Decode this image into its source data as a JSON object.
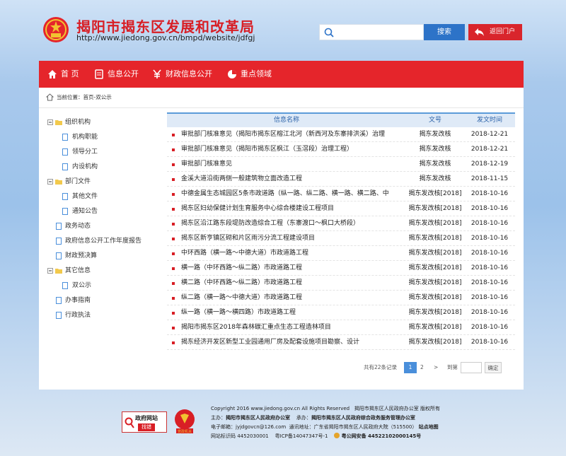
{
  "header": {
    "title": "揭阳市揭东区发展和改革局",
    "url": "http://www.jiedong.gov.cn/bmpd/website/jdfgj",
    "search_placeholder": "",
    "search_button": "搜索",
    "return_button": "返回门户"
  },
  "nav": [
    {
      "label": "首 页",
      "icon": "home-icon"
    },
    {
      "label": "信息公开",
      "icon": "document-icon"
    },
    {
      "label": "财政信息公开",
      "icon": "money-icon"
    },
    {
      "label": "重点领域",
      "icon": "pie-chart-icon"
    }
  ],
  "breadcrumb": "当前位置：首页-双公示",
  "tree": [
    {
      "label": "组织机构",
      "type": "folder"
    },
    {
      "label": "机构职能",
      "type": "file"
    },
    {
      "label": "领导分工",
      "type": "file"
    },
    {
      "label": "内设机构",
      "type": "file"
    },
    {
      "label": "部门文件",
      "type": "folder"
    },
    {
      "label": "其他文件",
      "type": "file"
    },
    {
      "label": "通知公告",
      "type": "file"
    },
    {
      "label": "政务动态",
      "type": "file"
    },
    {
      "label": "政府信息公开工作年度报告",
      "type": "file"
    },
    {
      "label": "财政预决算",
      "type": "file"
    },
    {
      "label": "其它信息",
      "type": "folder"
    },
    {
      "label": "双公示",
      "type": "file"
    },
    {
      "label": "办事指南",
      "type": "file"
    },
    {
      "label": "行政执法",
      "type": "file"
    }
  ],
  "table": {
    "headers": [
      "信息名称",
      "文号",
      "发文时间"
    ],
    "rows": [
      [
        "审批部门核准意见（揭阳市揭东区榕江北河（新西河及东寨排洪溪）治理",
        "揭东发改核",
        "2018-12-21"
      ],
      [
        "审批部门核准意见（揭阳市揭东区枫江（玉滘段）治理工程）",
        "揭东发改核",
        "2018-12-21"
      ],
      [
        "审批部门核准意见",
        "揭东发改核",
        "2018-12-19"
      ],
      [
        "金溪大道沿街两侧一般建筑物立面改造工程",
        "揭东发改核",
        "2018-11-15"
      ],
      [
        "中德金属生态城园区5条市政道路（纵一路、纵二路、横一路、横二路、中",
        "揭东发改核[2018]",
        "2018-10-16"
      ],
      [
        "揭东区妇幼保健计划生育服务中心综合楼建设工程项目",
        "揭东发改核[2018]",
        "2018-10-16"
      ],
      [
        "揭东区沿江路东段堤防改造综合工程（东寨渡口～枫口大桥段）",
        "揭东发改核[2018]",
        "2018-10-16"
      ],
      [
        "揭东区新亨镇区砌和片区雨污分流工程建设项目",
        "揭东发改核[2018]",
        "2018-10-16"
      ],
      [
        "中环西路（横一路～中德大道）市政道路工程",
        "揭东发改核[2018]",
        "2018-10-16"
      ],
      [
        "横一路（中环西路～纵二路）市政道路工程",
        "揭东发改核[2018]",
        "2018-10-16"
      ],
      [
        "横二路（中环西路～纵二路）市政道路工程",
        "揭东发改核[2018]",
        "2018-10-16"
      ],
      [
        "纵二路（横一路～中德大道）市政道路工程",
        "揭东发改核[2018]",
        "2018-10-16"
      ],
      [
        "纵一路（横一路～横四路）市政道路工程",
        "揭东发改核[2018]",
        "2018-10-16"
      ],
      [
        "揭阳市揭东区2018年森林碳汇重点生态工程造林项目",
        "揭东发改核[2018]",
        "2018-10-16"
      ],
      [
        "揭东经济开发区新型工业园通用厂房及配套设施项目勘察、设计",
        "揭东发改核[2018]",
        "2018-10-16"
      ]
    ]
  },
  "pager": {
    "total": "共有22条记录",
    "pages": [
      "1",
      "2"
    ],
    "next": ">",
    "last": "»",
    "goto": "到第",
    "unit": "页",
    "confirm": "确定"
  },
  "footer": {
    "badge_gov_top": "政府网站",
    "badge_gov_bottom": "找错",
    "badge_party": "党政机关",
    "copyright": "Copyright 2016 www.jiedong.gov.cn All Rights Reserved",
    "copyright_owner": "揭阳市揭东区人民政府办公室 版权所有",
    "host_label": "主办：",
    "host": "揭阳市揭东区人民政府办公室",
    "undertake_label": "承办：",
    "undertake": "揭阳市揭东区人民政府综合政务服务管理办公室",
    "email": "电子邮箱：jyjdgovcn@126.com",
    "address": "通讯地址：广东省揭阳市揭东区人民政府大院（515500）",
    "sitemap": "站点地图",
    "site_id": "网站标识码 4452030001",
    "icp": "粤ICP备14047347号-1",
    "police": "粤公网安备 44522102000145号"
  },
  "colors": {
    "brand_red": "#e5252b",
    "link_blue": "#2d73c8"
  }
}
